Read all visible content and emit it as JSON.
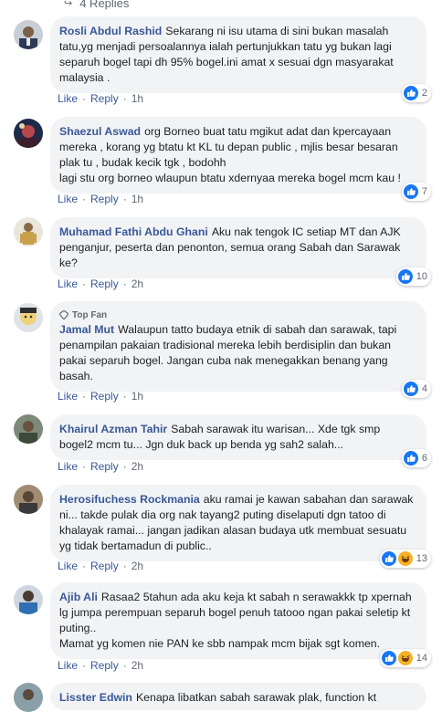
{
  "thread": {
    "replies_label": "4 Replies"
  },
  "actions": {
    "like": "Like",
    "reply": "Reply",
    "dot": "·"
  },
  "colors": {
    "author": "#385898",
    "bubble": "#f2f3f5",
    "like_blue": "#1877f2",
    "haha_yellow": "#f7b125"
  },
  "comments": [
    {
      "author": "Rosli Abdul Rashid",
      "text": "Sekarang ni isu utama di sini bukan masalah tatu,yg menjadi persoalannya ialah pertunjukkan tatu yg bukan lagi separuh bogel tapi dh 95% bogel.ini amat x sesuai dgn masyarakat malaysia .",
      "time": "1h",
      "reactions": [
        "like-icon"
      ],
      "count": "2"
    },
    {
      "author": "Shaezul Aswad",
      "text": "org Borneo buat tatu mgikut adat dan kpercayaan mereka , korang yg btatu kt KL tu depan public , mjlis besar besaran plak tu , budak kecik tgk , bodohh",
      "text2": "lagi stu org borneo wlaupun btatu xdernyaa mereka bogel mcm kau !",
      "time": "1h",
      "reactions": [
        "like-icon"
      ],
      "count": "7"
    },
    {
      "author": "Muhamad Fathi Abdu Ghani",
      "text": "Aku nak tengok IC setiap MT dan AJK penganjur, peserta dan penonton, semua orang Sabah dan Sarawak ke?",
      "time": "2h",
      "reactions": [
        "like-icon"
      ],
      "count": "10"
    },
    {
      "badge": "Top Fan",
      "author": "Jamal Mut",
      "text": "Walaupun tatto budaya etnik di sabah dan sarawak, tapi penampilan pakaian tradisional mereka lebih berdisiplin dan bukan pakai separuh bogel. Jangan cuba nak menegakkan benang yang basah.",
      "time": "1h",
      "reactions": [
        "like-icon"
      ],
      "count": "4"
    },
    {
      "author": "Khairul Azman Tahir",
      "text": "Sabah sarawak itu warisan... Xde tgk smp bogel2 mcm tu... Jgn duk back up benda yg sah2 salah...",
      "time": "2h",
      "reactions": [
        "like-icon"
      ],
      "count": "6"
    },
    {
      "author": "Herosifuchess Rockmania",
      "text": "aku ramai je kawan sabahan dan sarawak ni... takde pulak dia org nak tayang2 puting diselaputi dgn tatoo di khalayak ramai... jangan jadikan alasan budaya utk membuat sesuatu yg tidak bertamadun di public..",
      "time": "2h",
      "reactions": [
        "like-icon",
        "haha-icon"
      ],
      "count": "13"
    },
    {
      "author": "Ajib Ali",
      "text": "Rasaa2 5tahun ada aku keja kt sabah n serawakkk tp xpernah lg jumpa perempuan separuh bogel penuh tatooo ngan pakai seletip kt puting..",
      "text2": "Mamat yg komen nie PAN ke sbb nampak mcm bijak sgt komen.",
      "time": "2h",
      "reactions": [
        "like-icon",
        "haha-icon"
      ],
      "count": "14"
    },
    {
      "author": "Lisster Edwin",
      "text": "Kenapa libatkan sabah sarawak plak, function kt"
    }
  ]
}
